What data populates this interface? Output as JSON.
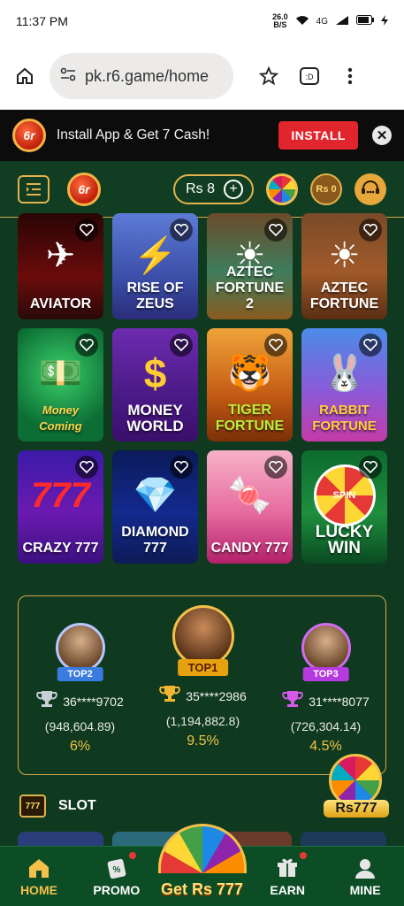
{
  "status_bar": {
    "time": "11:37 PM",
    "speed_value": "26.0",
    "speed_unit": "B/S",
    "network": "4G"
  },
  "browser": {
    "url": "pk.r6.game/home"
  },
  "install_banner": {
    "logo_text": "6r",
    "text": "Install App & Get 7 Cash!",
    "button_label": "INSTALL"
  },
  "header": {
    "logo_text": "6r",
    "balance_label": "Rs 8",
    "bag_label": "Rs 0"
  },
  "games": [
    {
      "title": "AVIATOR",
      "art": "✈"
    },
    {
      "title": "RISE OF ZEUS",
      "art": "⚡"
    },
    {
      "title": "AZTEC FORTUNE 2",
      "art": "☀"
    },
    {
      "title": "AZTEC FORTUNE",
      "art": "☀"
    },
    {
      "title": "Money Coming",
      "art": "💵"
    },
    {
      "title": "MONEY WORLD",
      "art": "$"
    },
    {
      "title": "TIGER FORTUNE",
      "art": "🐯"
    },
    {
      "title": "RABBIT FORTUNE",
      "art": "🐰"
    },
    {
      "title": "CRAZY 777",
      "art": "777"
    },
    {
      "title": "DIAMOND 777",
      "art": "💎"
    },
    {
      "title": "CANDY 777",
      "art": "🍬"
    },
    {
      "title": "LUCKY WIN",
      "art": "SPIN"
    }
  ],
  "leaderboard": [
    {
      "rank": "TOP2",
      "user": "36****9702",
      "amount": "(948,604.89)",
      "percent": "6%"
    },
    {
      "rank": "TOP1",
      "user": "35****2986",
      "amount": "(1,194,882.8)",
      "percent": "9.5%"
    },
    {
      "rank": "TOP3",
      "user": "31****8077",
      "amount": "(726,304.14)",
      "percent": "4.5%"
    }
  ],
  "slot_section": {
    "title": "SLOT",
    "icon_text": "777"
  },
  "float_promo": {
    "label": "Rs777"
  },
  "bottom_nav": {
    "home": "HOME",
    "promo": "PROMO",
    "center": "Get Rs 777",
    "earn": "EARN",
    "mine": "MINE"
  }
}
